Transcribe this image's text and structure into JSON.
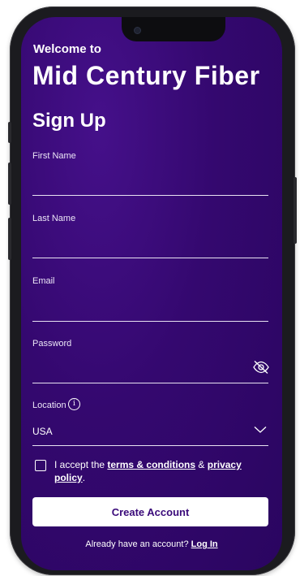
{
  "header": {
    "welcome": "Welcome to",
    "brand": "Mid Century Fiber",
    "title": "Sign Up"
  },
  "fields": {
    "first_name": {
      "label": "First Name",
      "value": ""
    },
    "last_name": {
      "label": "Last Name",
      "value": ""
    },
    "email": {
      "label": "Email",
      "value": ""
    },
    "password": {
      "label": "Password",
      "value": ""
    },
    "location": {
      "label": "Location",
      "value": "USA",
      "info_icon": "i"
    }
  },
  "terms": {
    "prefix": "I accept the ",
    "terms_link": "terms & conditions",
    "and": " & ",
    "privacy_link": "privacy policy",
    "suffix": "."
  },
  "actions": {
    "create_account": "Create Account",
    "login_prompt": "Already have an account? ",
    "login_link": "Log In"
  },
  "colors": {
    "background": "#34086f",
    "button_text": "#3a0a7a"
  },
  "icons": {
    "password_toggle": "eye-off-icon",
    "location_info": "info-icon",
    "location_dropdown": "chevron-down-icon"
  }
}
